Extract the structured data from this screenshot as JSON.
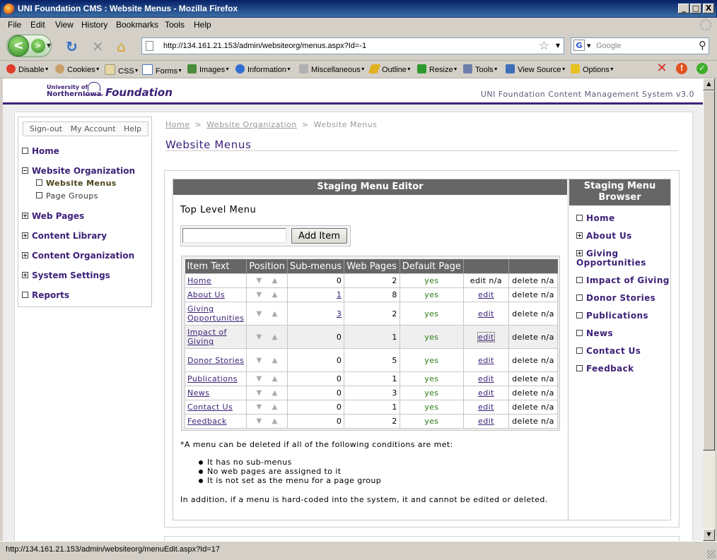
{
  "window": {
    "title": "UNI Foundation CMS : Website Menus - Mozilla Firefox",
    "minimize": "_",
    "maximize": "□",
    "close": "X"
  },
  "menubar": {
    "items": [
      "File",
      "Edit",
      "View",
      "History",
      "Bookmarks",
      "Tools",
      "Help"
    ]
  },
  "navbar": {
    "url": "http://134.161.21.153/admin/websiteorg/menus.aspx?Id=-1",
    "search_placeholder": "Google"
  },
  "devbar": {
    "items": [
      "Disable",
      "Cookies",
      "CSS",
      "Forms",
      "Images",
      "Information",
      "Miscellaneous",
      "Outline",
      "Resize",
      "Tools",
      "View Source",
      "Options"
    ],
    "icon_colors": [
      "#e23c2c",
      "#c9a06a",
      "#e6d8a0",
      "#4a78c4",
      "#4a8a3c",
      "#2f6fd1",
      "#b0b0b0",
      "#e0b020",
      "#2e9a2e",
      "#6b7fa8",
      "#3b6fb8",
      "#e8c020"
    ]
  },
  "header": {
    "logo_line1": "University of",
    "logo_line2": "NorthernIowa",
    "logo_foundation": "Foundation",
    "cms_title": "UNI Foundation Content Management System v3.0"
  },
  "sidebar": {
    "account_links": [
      "Sign-out",
      "My Account",
      "Help"
    ],
    "nav": [
      {
        "label": "Home",
        "box": "empty"
      },
      {
        "label": "Website Organization",
        "box": "minus"
      },
      {
        "label": "Website Menus",
        "box": "empty",
        "sub": true,
        "active": true
      },
      {
        "label": "Page Groups",
        "box": "empty",
        "sub": true
      },
      {
        "label": "Web Pages",
        "box": "plus"
      },
      {
        "label": "Content Library",
        "box": "plus"
      },
      {
        "label": "Content Organization",
        "box": "plus"
      },
      {
        "label": "System Settings",
        "box": "plus"
      },
      {
        "label": "Reports",
        "box": "empty"
      }
    ]
  },
  "breadcrumb": {
    "home": "Home",
    "sep1": ">",
    "org": "Website Organization",
    "sep2": ">",
    "current": "Website Menus"
  },
  "page_title": "Website Menus",
  "editor": {
    "heading": "Staging Menu Editor",
    "top_level_label": "Top Level Menu",
    "add_input_value": "",
    "add_button": "Add Item",
    "columns": [
      "Item Text",
      "Position",
      "Sub-menus",
      "Web Pages",
      "Default Page",
      "",
      ""
    ],
    "rows": [
      {
        "text": "Home",
        "submenus": "0",
        "submenus_link": false,
        "pages": "2",
        "default": "yes",
        "edit": "edit n/a",
        "edit_link": false,
        "delete": "delete n/a"
      },
      {
        "text": "About Us",
        "submenus": "1",
        "submenus_link": true,
        "pages": "8",
        "default": "yes",
        "edit": "edit",
        "edit_link": true,
        "delete": "delete n/a"
      },
      {
        "text": "Giving Opportunities",
        "submenus": "3",
        "submenus_link": true,
        "pages": "2",
        "default": "yes",
        "edit": "edit",
        "edit_link": true,
        "delete": "delete n/a"
      },
      {
        "text": "Impact of Giving",
        "submenus": "0",
        "submenus_link": false,
        "pages": "1",
        "default": "yes",
        "edit": "edit",
        "edit_link": true,
        "delete": "delete n/a",
        "highlight": true
      },
      {
        "text": "Donor Stories",
        "submenus": "0",
        "submenus_link": false,
        "pages": "5",
        "default": "yes",
        "edit": "edit",
        "edit_link": true,
        "delete": "delete n/a"
      },
      {
        "text": "Publications",
        "submenus": "0",
        "submenus_link": false,
        "pages": "1",
        "default": "yes",
        "edit": "edit",
        "edit_link": true,
        "delete": "delete n/a"
      },
      {
        "text": "News",
        "submenus": "0",
        "submenus_link": false,
        "pages": "3",
        "default": "yes",
        "edit": "edit",
        "edit_link": true,
        "delete": "delete n/a"
      },
      {
        "text": "Contact Us",
        "submenus": "0",
        "submenus_link": false,
        "pages": "1",
        "default": "yes",
        "edit": "edit",
        "edit_link": true,
        "delete": "delete n/a"
      },
      {
        "text": "Feedback",
        "submenus": "0",
        "submenus_link": false,
        "pages": "2",
        "default": "yes",
        "edit": "edit",
        "edit_link": true,
        "delete": "delete n/a"
      }
    ],
    "position_down": "▼",
    "position_up": "▲",
    "note_intro": "*A menu can be deleted if all of the following conditions are met:",
    "conditions": [
      "It has no sub-menus",
      "No web pages are assigned to it",
      "It is not set as the menu for a page group"
    ],
    "note_after": "In addition, if a menu is hard-coded into the system, it and cannot be edited or deleted."
  },
  "browser": {
    "heading": "Staging Menu Browser",
    "items": [
      {
        "label": "Home",
        "box": "empty"
      },
      {
        "label": "About Us",
        "box": "plus"
      },
      {
        "label": "Giving Opportunities",
        "box": "plus"
      },
      {
        "label": "Impact of Giving",
        "box": "empty"
      },
      {
        "label": "Donor Stories",
        "box": "empty"
      },
      {
        "label": "Publications",
        "box": "empty"
      },
      {
        "label": "News",
        "box": "empty"
      },
      {
        "label": "Contact Us",
        "box": "empty"
      },
      {
        "label": "Feedback",
        "box": "empty"
      }
    ]
  },
  "status": {
    "text": "http://134.161.21.153/admin/websiteorg/menuEdit.aspx?Id=17"
  }
}
